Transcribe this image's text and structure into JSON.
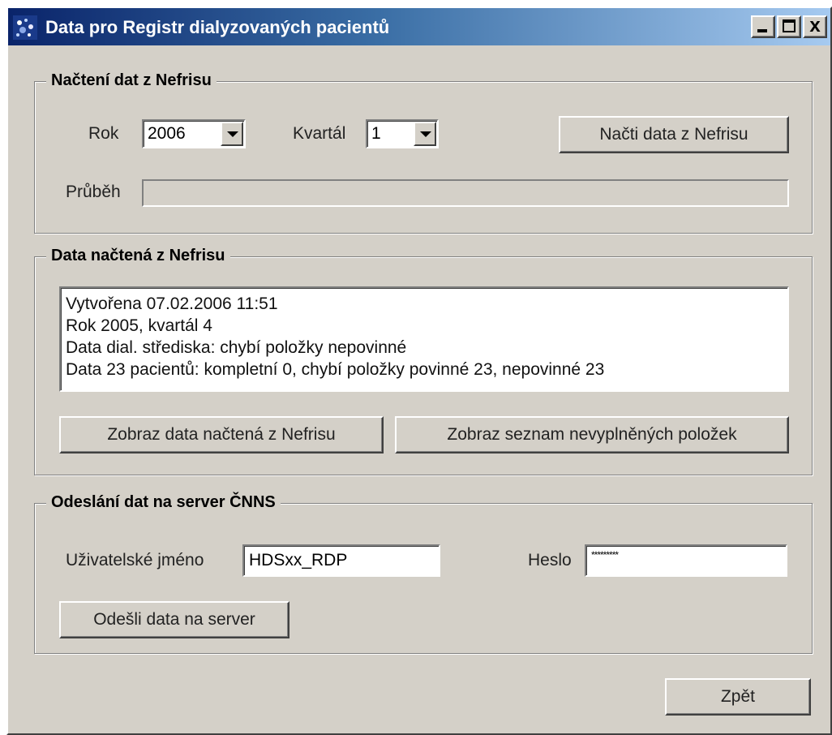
{
  "window": {
    "title": "Data pro Registr dialyzovaných pacientů",
    "icon": "app-icon"
  },
  "titlebar_buttons": {
    "minimize_icon": "minimize-icon",
    "maximize_icon": "maximize-icon",
    "close_icon": "close-icon",
    "close_glyph": "x"
  },
  "load_group": {
    "legend": "Načtení dat z Nefrisu",
    "year_label": "Rok",
    "year_value": "2006",
    "quarter_label": "Kvartál",
    "quarter_value": "1",
    "load_button": "Načti data z Nefrisu",
    "progress_label": "Průběh",
    "progress_value": 0
  },
  "data_group": {
    "legend": "Data načtená z Nefrisu",
    "info_lines": [
      "Vytvořena 07.02.2006 11:51",
      "Rok 2005, kvartál 4",
      "Data dial. střediska: chybí položky nepovinné",
      "Data 23 pacientů: kompletní 0, chybí položky povinné 23, nepovinné 23"
    ],
    "show_data_button": "Zobraz data načtená z Nefrisu",
    "show_missing_button": "Zobraz seznam nevyplněných položek"
  },
  "send_group": {
    "legend": "Odeslání dat na server ČNNS",
    "username_label": "Uživatelské jméno",
    "username_value": "HDSxx_RDP",
    "password_label": "Heslo",
    "password_value": "*********",
    "send_button": "Odešli data na server"
  },
  "footer": {
    "back_button": "Zpět"
  },
  "colors": {
    "face": "#d4d0c8",
    "title_start": "#0a246a",
    "title_end": "#a6caf0"
  }
}
